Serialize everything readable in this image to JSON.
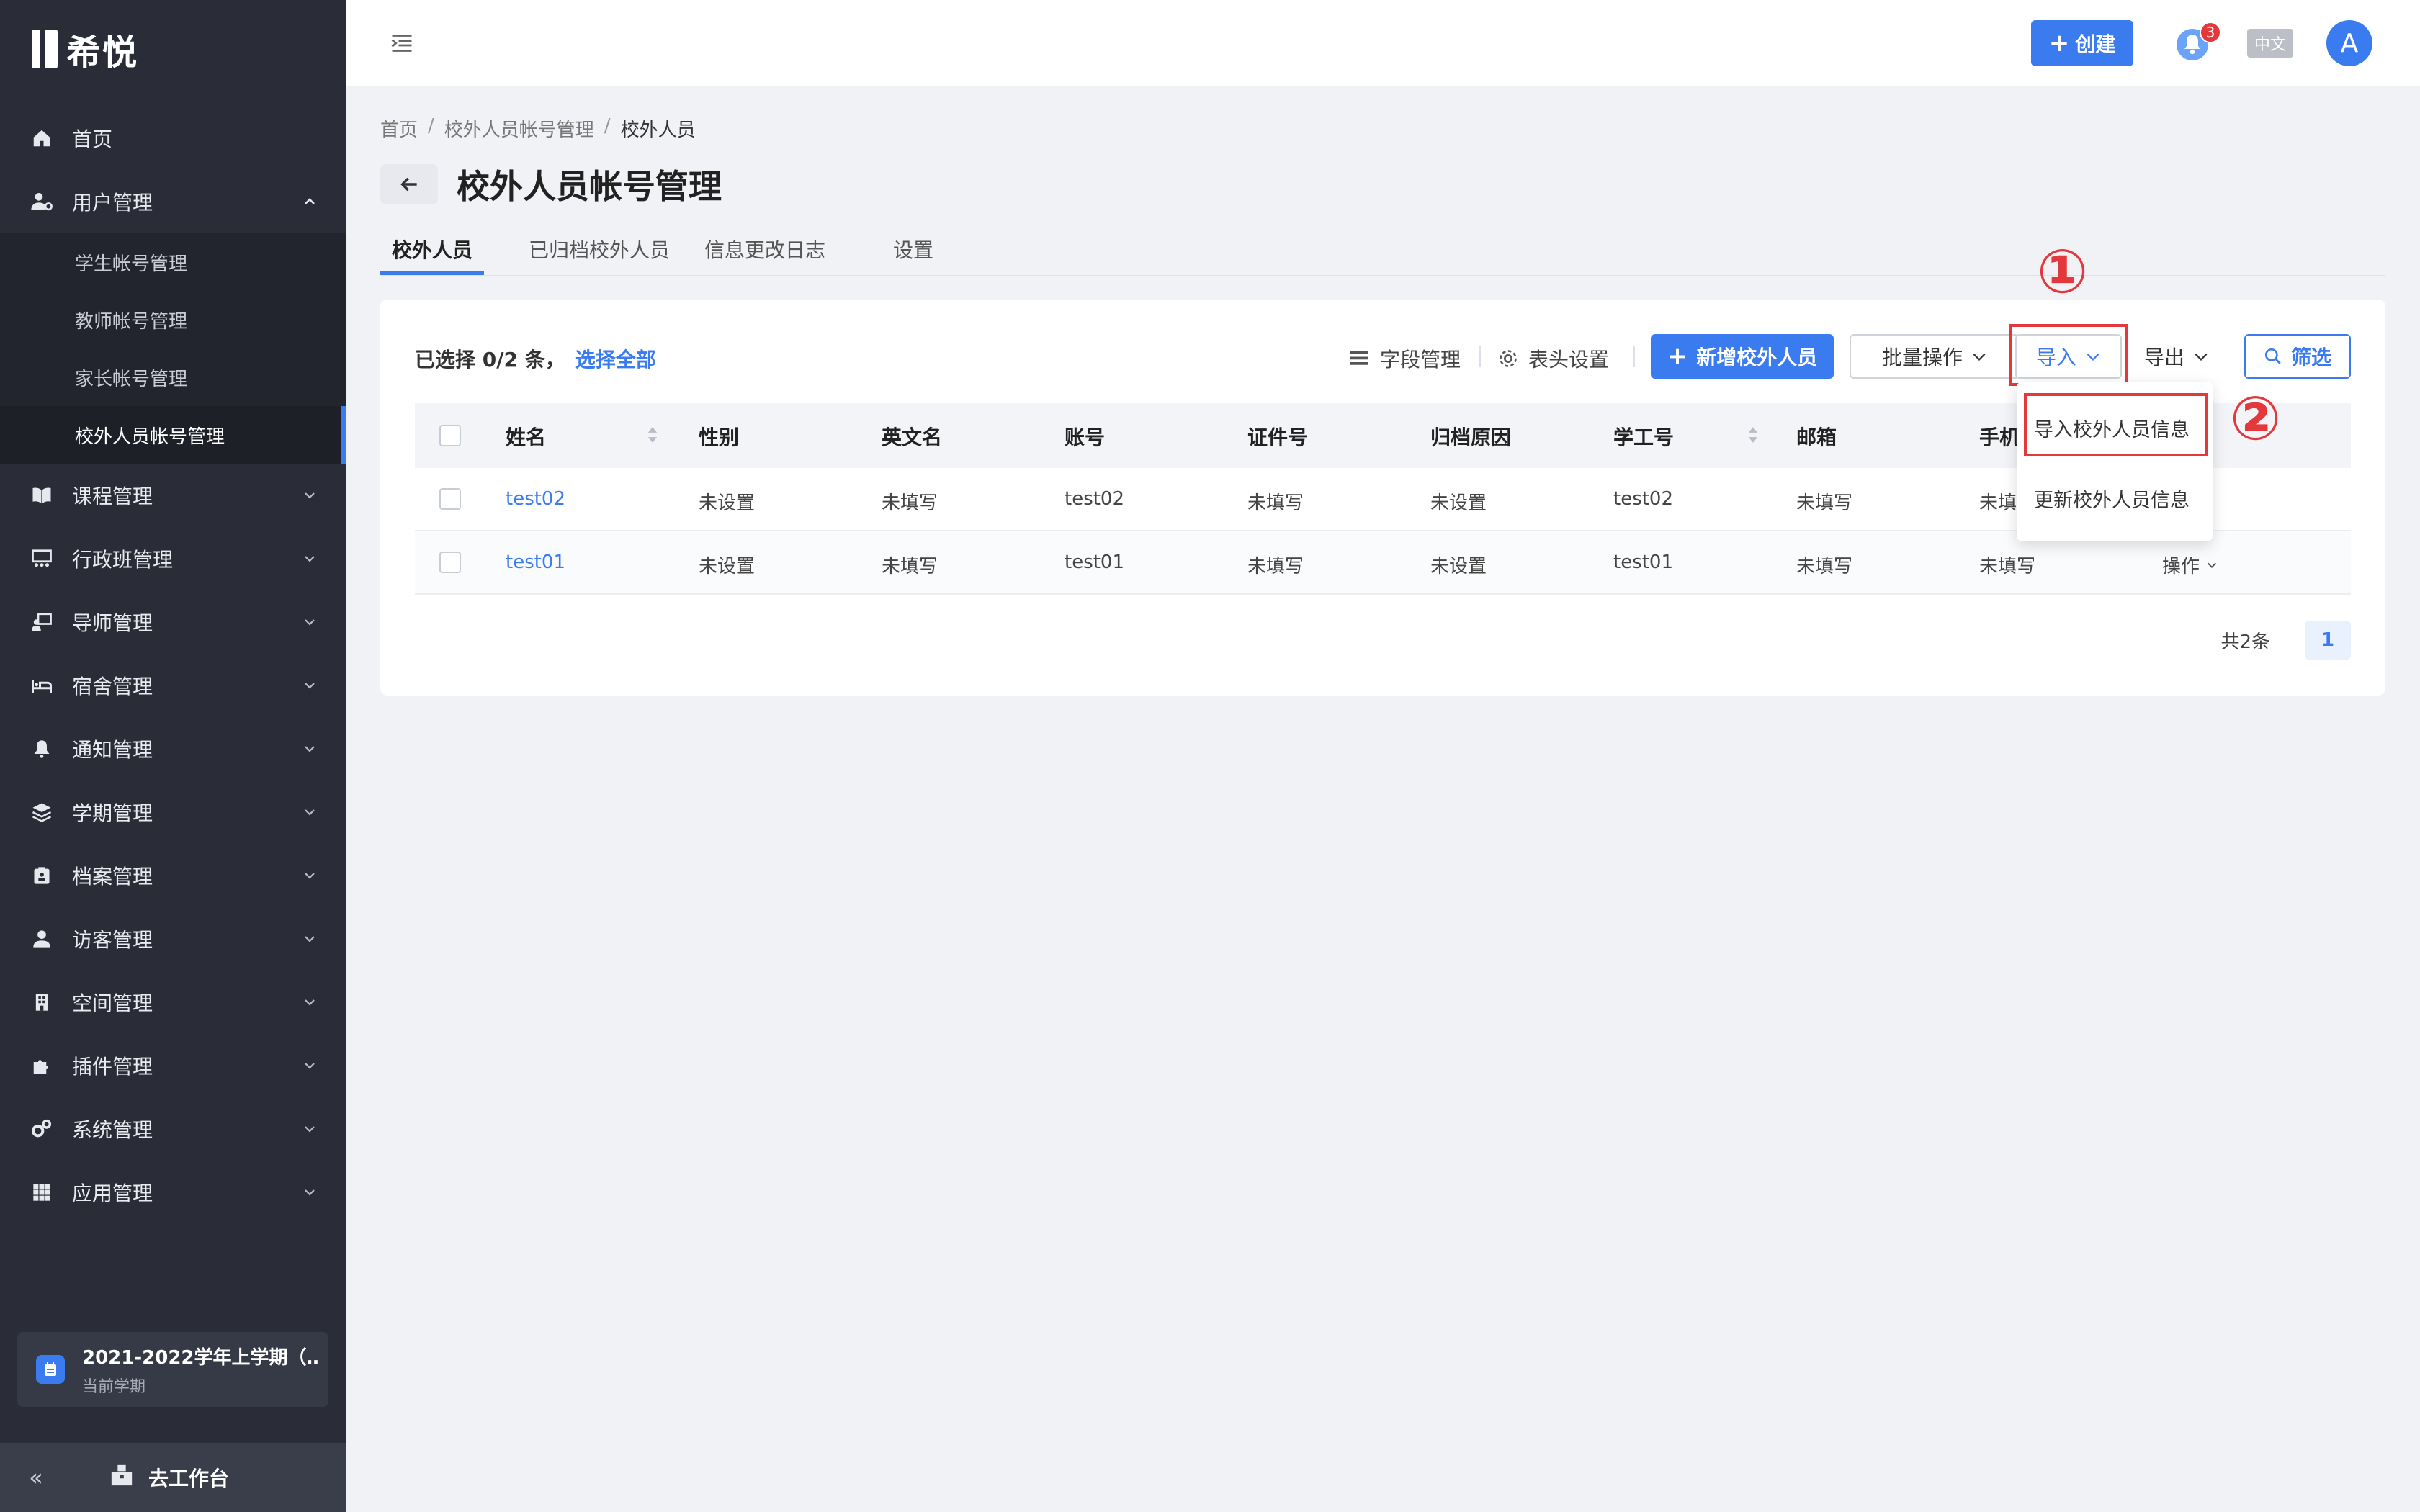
{
  "app": {
    "name": "希悦"
  },
  "sidebar": {
    "items": [
      {
        "label": "首页",
        "icon": "home-icon"
      },
      {
        "label": "用户管理",
        "icon": "user-gear-icon",
        "expanded": true,
        "children": [
          "学生帐号管理",
          "教师帐号管理",
          "家长帐号管理",
          "校外人员帐号管理"
        ]
      },
      {
        "label": "课程管理",
        "icon": "book-icon"
      },
      {
        "label": "行政班管理",
        "icon": "class-icon"
      },
      {
        "label": "导师管理",
        "icon": "tutor-icon"
      },
      {
        "label": "宿舍管理",
        "icon": "bed-icon"
      },
      {
        "label": "通知管理",
        "icon": "bell-icon"
      },
      {
        "label": "学期管理",
        "icon": "layers-icon"
      },
      {
        "label": "档案管理",
        "icon": "archive-icon"
      },
      {
        "label": "访客管理",
        "icon": "visitor-icon"
      },
      {
        "label": "空间管理",
        "icon": "building-icon"
      },
      {
        "label": "插件管理",
        "icon": "puzzle-icon"
      },
      {
        "label": "系统管理",
        "icon": "gears-icon"
      },
      {
        "label": "应用管理",
        "icon": "grid-icon"
      }
    ],
    "term": {
      "title": "2021-2022学年上学期（…",
      "subtitle": "当前学期"
    },
    "collapse": "«",
    "goto_workbench": "去工作台"
  },
  "header": {
    "create_label": "创建",
    "notification_count": "3",
    "language": "中文",
    "avatar_letter": "A"
  },
  "breadcrumb": [
    "首页",
    "校外人员帐号管理",
    "校外人员"
  ],
  "breadcrumb_sep": "/",
  "page": {
    "title": "校外人员帐号管理"
  },
  "tabs": [
    "校外人员",
    "已归档校外人员",
    "信息更改日志",
    "设置"
  ],
  "toolbar": {
    "selected_text": "已选择 0/2 条，",
    "select_all": "选择全部",
    "field_manage": "字段管理",
    "header_settings": "表头设置",
    "add_label": "新增校外人员",
    "batch_label": "批量操作",
    "import_label": "导入",
    "export_label": "导出",
    "filter_label": "筛选"
  },
  "annotations": {
    "step1": "①",
    "step2": "②"
  },
  "import_menu": [
    "导入校外人员信息",
    "更新校外人员信息"
  ],
  "table": {
    "columns": [
      "姓名",
      "性别",
      "英文名",
      "账号",
      "证件号",
      "归档原因",
      "学工号",
      "邮箱",
      "手机"
    ],
    "rows": [
      {
        "name": "test02",
        "gender": "未设置",
        "english_name": "未填写",
        "account": "test02",
        "id_number": "未填写",
        "archive_reason": "未设置",
        "staff_id": "test02",
        "email": "未填写",
        "phone": "未填",
        "action": ""
      },
      {
        "name": "test01",
        "gender": "未设置",
        "english_name": "未填写",
        "account": "test01",
        "id_number": "未填写",
        "archive_reason": "未设置",
        "staff_id": "test01",
        "email": "未填写",
        "phone": "未填写",
        "action": "操作"
      }
    ]
  },
  "pagination": {
    "total": "共2条",
    "current": "1"
  },
  "colors": {
    "primary": "#3b7bf0",
    "sidebar": "#2a2d37",
    "highlight": "#e4393c"
  }
}
